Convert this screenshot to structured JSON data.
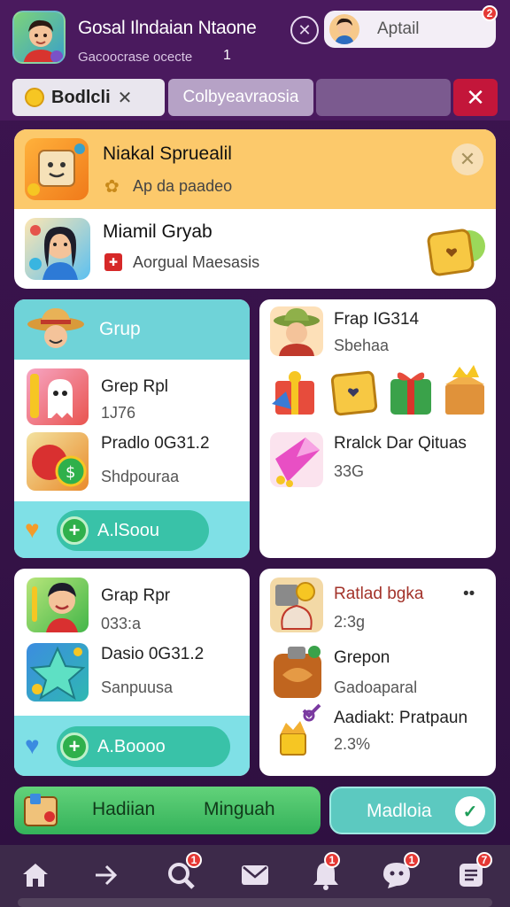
{
  "header": {
    "title": "Gosal Ilndaian Ntaone",
    "subtitle": "Gacoocrase ocecte",
    "subtitle_count": "1",
    "profile_label": "Aptail",
    "profile_badge": "2"
  },
  "tabs": [
    {
      "label": "Bodlcli"
    },
    {
      "label": "Colbyeavraosia"
    },
    {
      "label": ""
    }
  ],
  "featured": {
    "row1": {
      "title": "Niakal Spruealil",
      "subtitle": "Ap da paadeo"
    },
    "row2": {
      "title": "Miamil Gryab",
      "subtitle": "Aorgual Maesasis"
    }
  },
  "card_a": {
    "header": "Grup",
    "item1_title": "Grep Rpl",
    "item1_value": "1J76",
    "item2_title": "Pradlo 0G31.2",
    "item2_sub": "Shdpouraa",
    "button": "A.lSoou"
  },
  "card_b": {
    "item1_title": "Frap IG314",
    "item1_sub": "Sbehaa",
    "item2_title": "Rralck Dar Qituas",
    "item2_value": "33G"
  },
  "card_c": {
    "item1_title": "Grap Rpr",
    "item1_value": "033:a",
    "item2_title": "Dasio 0G31.2",
    "item2_sub": "Sanpuusa",
    "button": "A.Boooo"
  },
  "card_d": {
    "item1_title": "Ratlad bgka",
    "item1_value": "2:3g",
    "more": "••",
    "item2_title": "Grepon",
    "item2_sub": "Gadoaparal",
    "item3_title": "Aadiakt: Pratpaun",
    "item3_value": "2.3%"
  },
  "actions": {
    "primary_left": "Hadiian",
    "primary_right": "Minguah",
    "secondary": "Madloia"
  },
  "nav": {
    "search_badge": "1",
    "bell_badge": "1",
    "chat_badge": "1",
    "list_badge": "7"
  },
  "colors": {
    "background": "#3d1450",
    "accent_orange": "#fcc96b",
    "accent_teal": "#6fd3d8",
    "accent_green": "#34b25a",
    "close_red": "#c3163a"
  }
}
